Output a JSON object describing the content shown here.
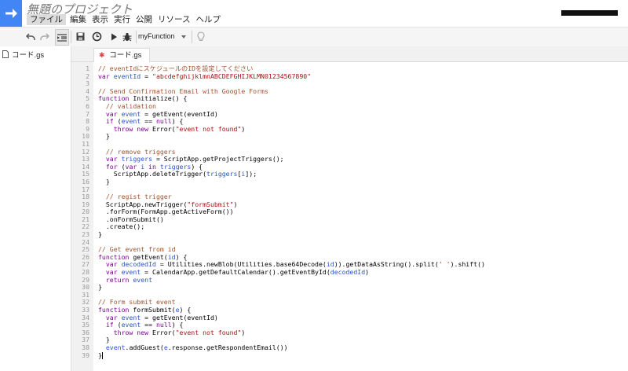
{
  "app": {
    "title": "無題のプロジェクト",
    "menu": [
      "ファイル",
      "編集",
      "表示",
      "実行",
      "公開",
      "リソース",
      "ヘルプ"
    ]
  },
  "toolbar": {
    "function_select": "myFunction",
    "icons": [
      "undo-icon",
      "redo-icon",
      "indent-icon",
      "save-icon",
      "trigger-clock-icon",
      "run-play-icon",
      "debug-bug-icon",
      "lightbulb-icon"
    ]
  },
  "sidebar": {
    "files": [
      {
        "name": "コード.gs"
      }
    ]
  },
  "tabs": [
    {
      "label": "コード.gs",
      "modified_mark": "✱"
    }
  ],
  "colors": {
    "logo_blue": "#4285f4",
    "comment": "#a0522d",
    "keyword": "#7a0090",
    "string": "#aa1111",
    "variable": "#2a55c4"
  },
  "code_lines": [
    [
      [
        "c",
        "// eventIdにスケジュールのIDを設定してください"
      ]
    ],
    [
      [
        "k",
        "var "
      ],
      [
        "v",
        "eventId"
      ],
      [
        "d",
        " = "
      ],
      [
        "s",
        "\"abcdefghijklmnABCDEFGHIJKLMN01234567890\""
      ]
    ],
    [],
    [
      [
        "c",
        "// Send Confirmation Email with Google Forms"
      ]
    ],
    [
      [
        "k",
        "function "
      ],
      [
        "d",
        "Initialize() {"
      ]
    ],
    [
      [
        "d",
        "  "
      ],
      [
        "c",
        "// validation"
      ]
    ],
    [
      [
        "d",
        "  "
      ],
      [
        "k",
        "var "
      ],
      [
        "v",
        "event"
      ],
      [
        "d",
        " = getEvent(eventId)"
      ]
    ],
    [
      [
        "d",
        "  "
      ],
      [
        "k",
        "if "
      ],
      [
        "d",
        "("
      ],
      [
        "v",
        "event"
      ],
      [
        "d",
        " == "
      ],
      [
        "k",
        "null"
      ],
      [
        "d",
        ") {"
      ]
    ],
    [
      [
        "d",
        "    "
      ],
      [
        "k",
        "throw new "
      ],
      [
        "d",
        "Error("
      ],
      [
        "s",
        "\"event not found\""
      ],
      [
        "d",
        ")"
      ]
    ],
    [
      [
        "d",
        "  }"
      ]
    ],
    [],
    [
      [
        "d",
        "  "
      ],
      [
        "c",
        "// remove triggers"
      ]
    ],
    [
      [
        "d",
        "  "
      ],
      [
        "k",
        "var "
      ],
      [
        "v",
        "triggers"
      ],
      [
        "d",
        " = ScriptApp.getProjectTriggers();"
      ]
    ],
    [
      [
        "d",
        "  "
      ],
      [
        "k",
        "for "
      ],
      [
        "d",
        "("
      ],
      [
        "k",
        "var "
      ],
      [
        "v",
        "i"
      ],
      [
        "k",
        " in "
      ],
      [
        "v",
        "triggers"
      ],
      [
        "d",
        ") {"
      ]
    ],
    [
      [
        "d",
        "    ScriptApp.deleteTrigger("
      ],
      [
        "v",
        "triggers"
      ],
      [
        "d",
        "["
      ],
      [
        "v",
        "i"
      ],
      [
        "d",
        "]);"
      ]
    ],
    [
      [
        "d",
        "  }"
      ]
    ],
    [],
    [
      [
        "d",
        "  "
      ],
      [
        "c",
        "// regist trigger"
      ]
    ],
    [
      [
        "d",
        "  ScriptApp.newTrigger("
      ],
      [
        "s",
        "\"formSubmit\""
      ],
      [
        "d",
        ")"
      ]
    ],
    [
      [
        "d",
        "  .forForm(FormApp.getActiveForm())"
      ]
    ],
    [
      [
        "d",
        "  .onFormSubmit()"
      ]
    ],
    [
      [
        "d",
        "  .create();"
      ]
    ],
    [
      [
        "d",
        "}"
      ]
    ],
    [],
    [
      [
        "c",
        "// Get event from id"
      ]
    ],
    [
      [
        "k",
        "function "
      ],
      [
        "d",
        "getEvent("
      ],
      [
        "v",
        "id"
      ],
      [
        "d",
        ") {"
      ]
    ],
    [
      [
        "d",
        "  "
      ],
      [
        "k",
        "var "
      ],
      [
        "v",
        "decodedId"
      ],
      [
        "d",
        " = Utilities.newBlob(Utilities.base64Decode("
      ],
      [
        "v",
        "id"
      ],
      [
        "d",
        ")).getDataAsString().split("
      ],
      [
        "s",
        "' '"
      ],
      [
        "d",
        ").shift()"
      ]
    ],
    [
      [
        "d",
        "  "
      ],
      [
        "k",
        "var "
      ],
      [
        "v",
        "event"
      ],
      [
        "d",
        " = CalendarApp.getDefaultCalendar().getEventById("
      ],
      [
        "v",
        "decodedId"
      ],
      [
        "d",
        ")"
      ]
    ],
    [
      [
        "d",
        "  "
      ],
      [
        "k",
        "return "
      ],
      [
        "v",
        "event"
      ]
    ],
    [
      [
        "d",
        "}"
      ]
    ],
    [],
    [
      [
        "c",
        "// Form submit event"
      ]
    ],
    [
      [
        "k",
        "function "
      ],
      [
        "d",
        "formSubmit("
      ],
      [
        "v",
        "e"
      ],
      [
        "d",
        ") {"
      ]
    ],
    [
      [
        "d",
        "  "
      ],
      [
        "k",
        "var "
      ],
      [
        "v",
        "event"
      ],
      [
        "d",
        " = getEvent(eventId)"
      ]
    ],
    [
      [
        "d",
        "  "
      ],
      [
        "k",
        "if "
      ],
      [
        "d",
        "("
      ],
      [
        "v",
        "event"
      ],
      [
        "d",
        " == "
      ],
      [
        "k",
        "null"
      ],
      [
        "d",
        ") {"
      ]
    ],
    [
      [
        "d",
        "    "
      ],
      [
        "k",
        "throw new "
      ],
      [
        "d",
        "Error("
      ],
      [
        "s",
        "\"event not found\""
      ],
      [
        "d",
        ")"
      ]
    ],
    [
      [
        "d",
        "  }"
      ]
    ],
    [
      [
        "d",
        "  "
      ],
      [
        "v",
        "event"
      ],
      [
        "d",
        ".addGuest("
      ],
      [
        "v",
        "e"
      ],
      [
        "d",
        ".response.getRespondentEmail())"
      ]
    ],
    [
      [
        "d",
        "}"
      ]
    ]
  ]
}
